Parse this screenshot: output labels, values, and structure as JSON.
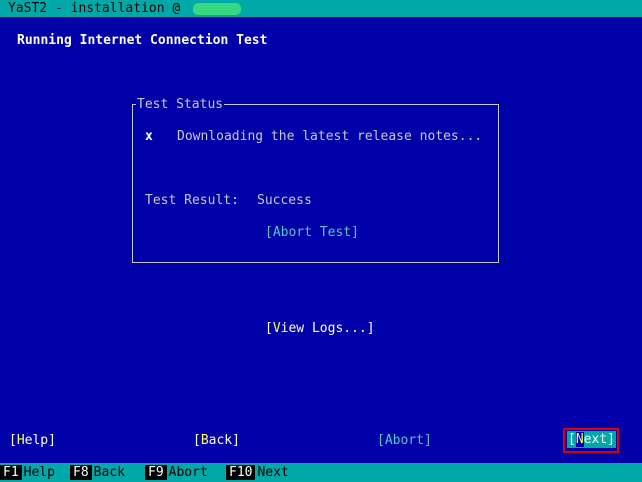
{
  "window": {
    "title": "YaST2 - installation @"
  },
  "dialog": {
    "heading": "Running Internet Connection Test",
    "frame_label": "Test Status",
    "test_item": {
      "mark": "x",
      "text": "Downloading the latest release notes..."
    },
    "result_label": "Test Result:",
    "result_value": "Success",
    "abort_test": {
      "pre": "[",
      "hot": "A",
      "rest": "bort Test]"
    },
    "view_logs": {
      "pre": "[",
      "hot": "V",
      "rest": "iew Logs...]"
    }
  },
  "buttons": {
    "help": {
      "pre": "[",
      "hot": "H",
      "rest": "elp]"
    },
    "back": {
      "pre": "[",
      "hot": "B",
      "rest": "ack]"
    },
    "abort": {
      "pre": "[",
      "hot": "A",
      "rest": "bort]"
    },
    "next": {
      "pre": "[",
      "hot": "N",
      "rest": "ext]"
    }
  },
  "function_keys": [
    {
      "key": "F1",
      "label": "Help"
    },
    {
      "key": "F8",
      "label": "Back"
    },
    {
      "key": "F9",
      "label": "Abort"
    },
    {
      "key": "F10",
      "label": "Next"
    }
  ],
  "colors": {
    "background": "#0000a8",
    "bars": "#00a8a8",
    "hotkey": "#ffff55",
    "focus_outline": "#e00000"
  }
}
